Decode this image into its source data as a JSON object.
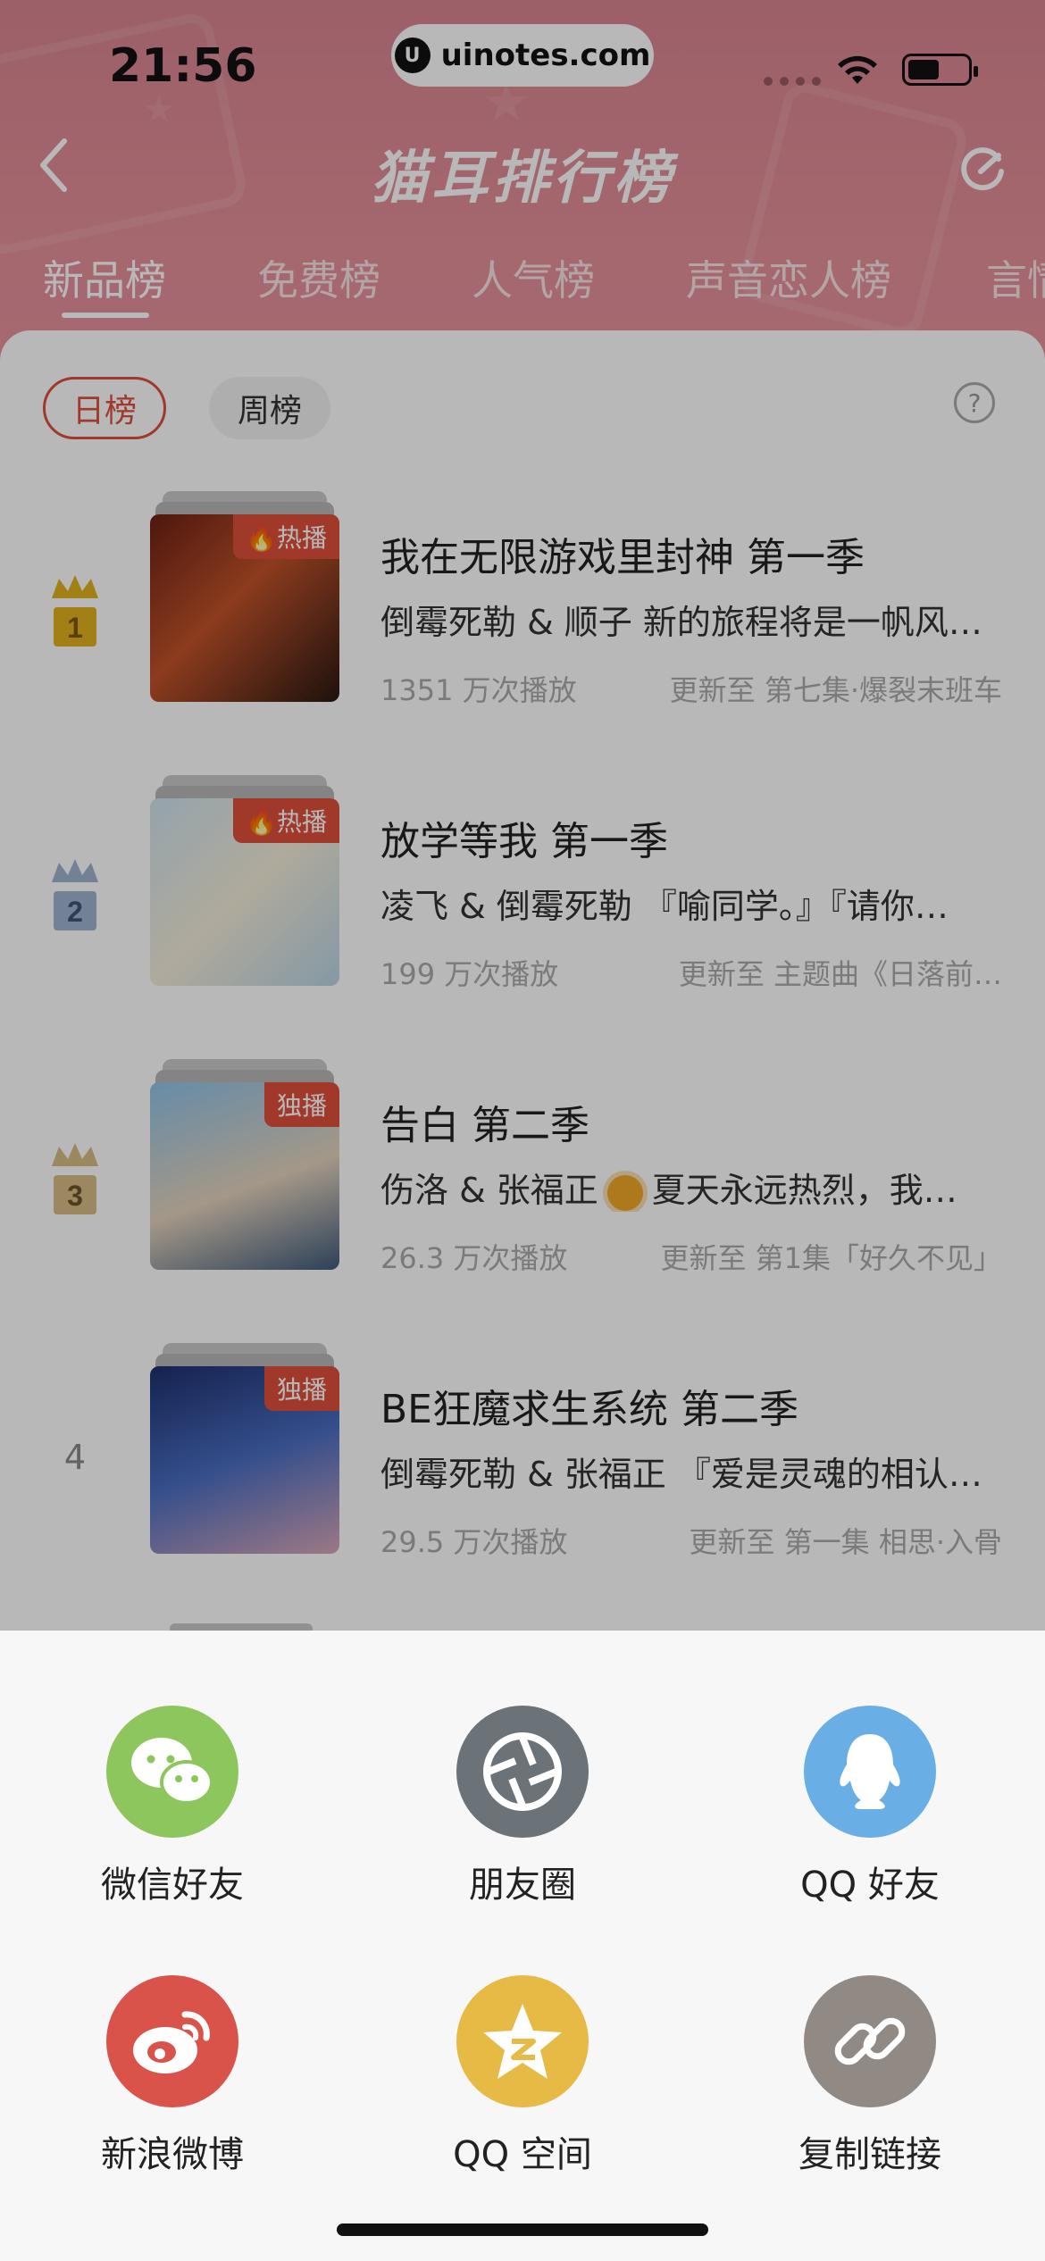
{
  "status_bar": {
    "time": "21:56",
    "url": "uinotes.com",
    "url_logo": "U"
  },
  "header": {
    "title": "猫耳排行榜",
    "back_icon": "chevron-left-icon",
    "refresh_icon": "refresh-icon"
  },
  "tabs": [
    {
      "label": "新品榜",
      "active": true
    },
    {
      "label": "免费榜",
      "active": false
    },
    {
      "label": "人气榜",
      "active": false
    },
    {
      "label": "声音恋人榜",
      "active": false
    },
    {
      "label": "言情",
      "active": false
    }
  ],
  "segments": {
    "daily": "日榜",
    "weekly": "周榜",
    "help": "?"
  },
  "rank_items": [
    {
      "rank": "1",
      "badge": "🔥热播",
      "title": "我在无限游戏里封神 第一季",
      "desc": "倒霉死勒 & 顺子 新的旅程将是一帆风顺的…",
      "plays": "1351 万次播放",
      "update": "更新至 第七集·爆裂末班车"
    },
    {
      "rank": "2",
      "badge": "🔥热播",
      "title": "放学等我 第一季",
      "desc": "凌飞 & 倒霉死勒 『喻同学。』『请你…",
      "plays": "199 万次播放",
      "update": "更新至 主题曲《日落前…"
    },
    {
      "rank": "3",
      "badge": "独播",
      "title": "告白 第二季",
      "desc_a": "伤洛 & 张福正",
      "desc_b": "夏天永远热烈，我…",
      "plays": "26.3 万次播放",
      "update": "更新至 第1集「好久不见」"
    },
    {
      "rank": "4",
      "badge": "独播",
      "title": "BE狂魔求生系统 第二季",
      "desc": "倒霉死勒 & 张福正 『爱是灵魂的相认…",
      "plays": "29.5 万次播放",
      "update": "更新至 第一集 相思·入骨"
    }
  ],
  "share_sheet": [
    {
      "label": "微信好友",
      "icon": "wechat-icon",
      "color": "#8cc65c"
    },
    {
      "label": "朋友圈",
      "icon": "moments-icon",
      "color": "#6b7278"
    },
    {
      "label": "QQ 好友",
      "icon": "qq-icon",
      "color": "#6aaee6"
    },
    {
      "label": "新浪微博",
      "icon": "weibo-icon",
      "color": "#d9534a"
    },
    {
      "label": "QQ 空间",
      "icon": "qzone-icon",
      "color": "#e7b945"
    },
    {
      "label": "复制链接",
      "icon": "link-icon",
      "color": "#918a84"
    }
  ],
  "colors": {
    "accent": "#e0503c",
    "header_bg": "#e58f99"
  }
}
